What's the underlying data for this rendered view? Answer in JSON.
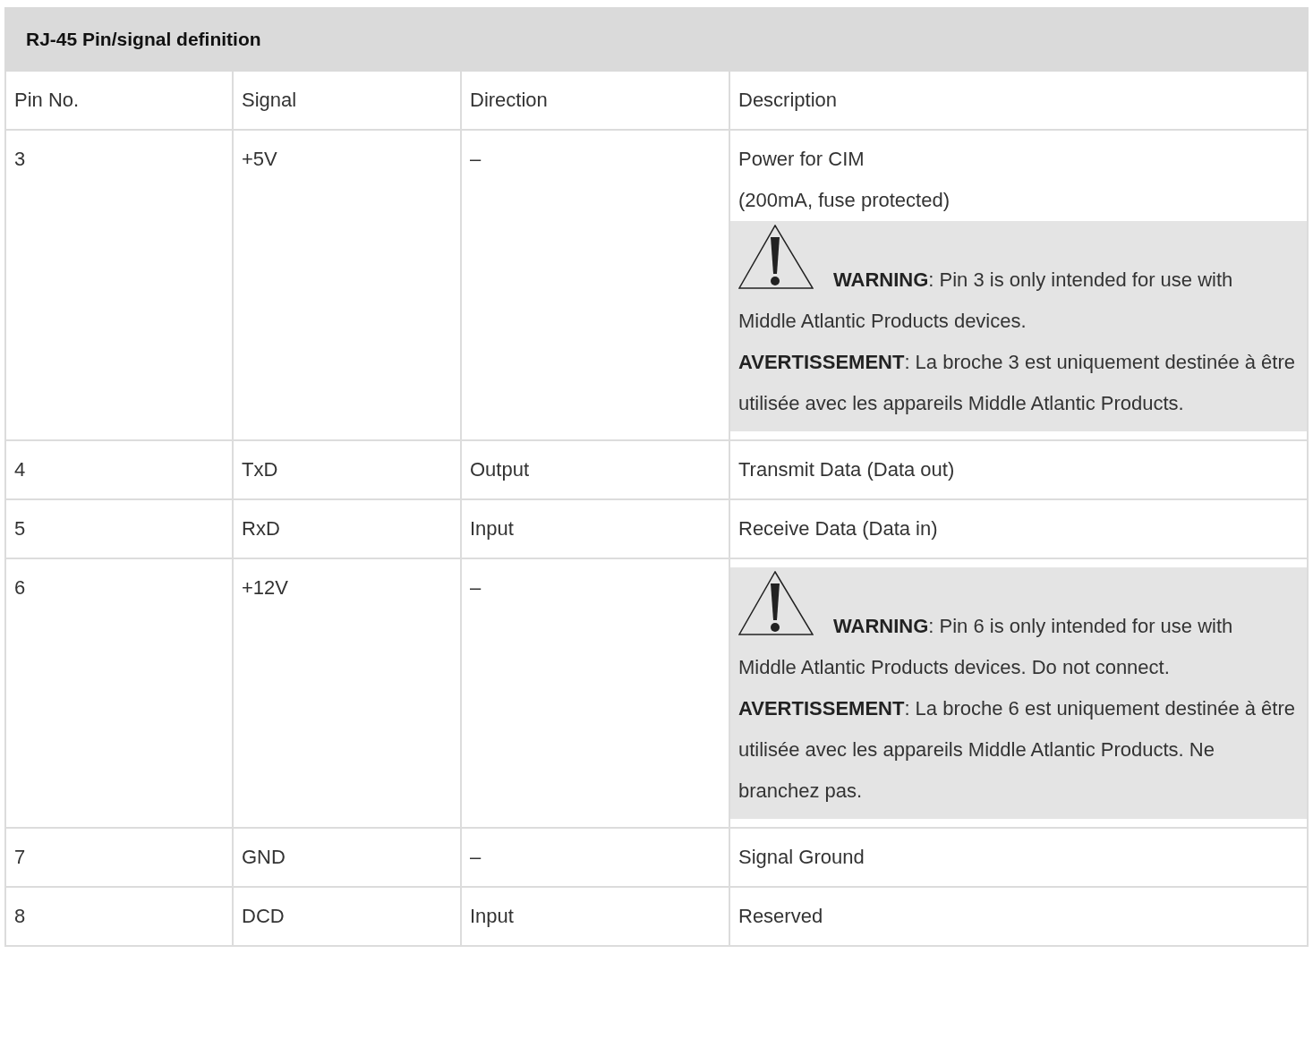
{
  "table": {
    "title": "RJ-45 Pin/signal definition",
    "columns": [
      "Pin No.",
      "Signal",
      "Direction",
      "Description"
    ],
    "rows": [
      {
        "pin": "3",
        "signal": "+5V",
        "direction": "–",
        "description": [
          "Power for CIM",
          "(200mA, fuse protected)"
        ],
        "warning": [
          "**WARNING**: Pin 3 is only intended for use with Middle Atlantic Products devices.",
          "**AVERTISSEMENT**: La broche 3 est uniquement destinée à être utilisée avec les appareils Middle Atlantic Products."
        ]
      },
      {
        "pin": "4",
        "signal": "TxD",
        "direction": "Output",
        "description": [
          "Transmit Data (Data out)"
        ]
      },
      {
        "pin": "5",
        "signal": "RxD",
        "direction": "Input",
        "description": [
          "Receive Data (Data in)"
        ]
      },
      {
        "pin": "6",
        "signal": "+12V",
        "direction": "–",
        "warning": [
          "**WARNING**: Pin 6 is only intended for use with Middle Atlantic Products devices. Do not connect.",
          "**AVERTISSEMENT**: La broche 6 est uniquement destinée à être utilisée avec les appareils Middle Atlantic Products. Ne branchez pas."
        ]
      },
      {
        "pin": "7",
        "signal": "GND",
        "direction": "–",
        "description": [
          "Signal Ground"
        ]
      },
      {
        "pin": "8",
        "signal": "DCD",
        "direction": "Input",
        "description": [
          "Reserved"
        ]
      }
    ]
  }
}
